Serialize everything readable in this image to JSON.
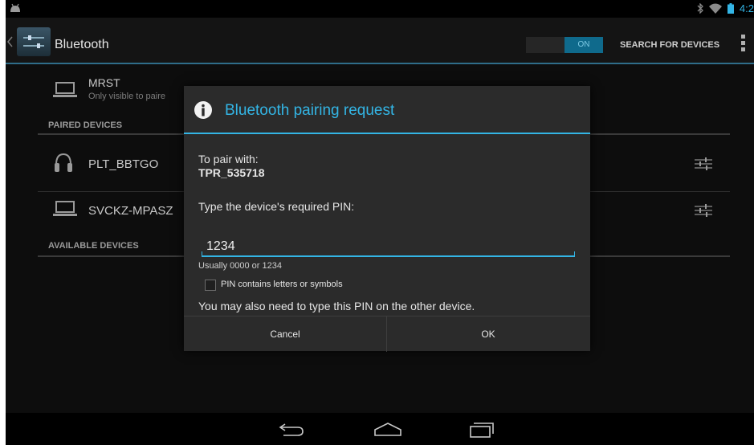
{
  "status_bar": {
    "time": "4:2",
    "icons": [
      "android-icon",
      "bluetooth-icon",
      "wifi-icon",
      "battery-icon"
    ]
  },
  "action_bar": {
    "title": "Bluetooth",
    "toggle_label": "ON",
    "search_label": "SEARCH FOR DEVICES"
  },
  "this_device": {
    "name": "MRST",
    "subtitle": "Only visible to paire"
  },
  "paired_header": "PAIRED DEVICES",
  "paired_devices": [
    {
      "name": "PLT_BBTGO",
      "icon": "headset-icon"
    },
    {
      "name": "SVCKZ-MPASZ",
      "icon": "laptop-icon"
    }
  ],
  "available_header": "AVAILABLE DEVICES",
  "dialog": {
    "title": "Bluetooth pairing request",
    "pair_with_label": "To pair with:",
    "device_name": "TPR_535718",
    "pin_prompt": "Type the device's required PIN:",
    "pin_value": "1234",
    "hint": "Usually 0000 or 1234",
    "checkbox_label": "PIN contains letters or symbols",
    "checkbox_checked": false,
    "note": "You may also need to type this PIN on the other device.",
    "cancel_label": "Cancel",
    "ok_label": "OK"
  },
  "colors": {
    "accent": "#33b5e5",
    "background": "#0d0d0d",
    "dialog_bg": "#2b2b2b"
  }
}
